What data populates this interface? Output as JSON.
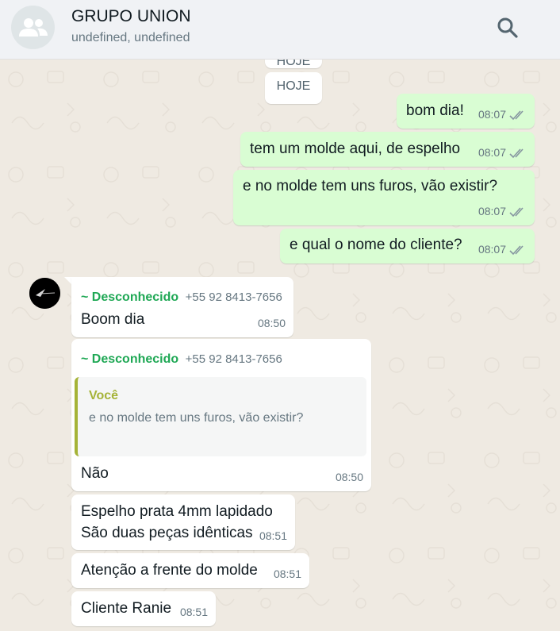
{
  "header": {
    "title": "GRUPO UNION",
    "subtitle": "undefined, undefined",
    "avatar_icon": "group-icon",
    "search_icon": "search-icon"
  },
  "chat": {
    "date_chip_top": "HOJE",
    "date_chip": "HOJE",
    "messages_out": [
      {
        "text": "bom dia!",
        "time": "08:07"
      },
      {
        "text": "tem um molde aqui, de espelho",
        "time": "08:07"
      },
      {
        "text": "e no molde tem uns furos, vão existir?",
        "time": "08:07"
      },
      {
        "text": "e qual o nome do cliente?",
        "time": "08:07"
      }
    ],
    "messages_in": [
      {
        "sender": "~ Desconhecido",
        "phone": "+55 92 8413-7656",
        "text": "Boom dia",
        "time": "08:50"
      },
      {
        "sender": "~ Desconhecido",
        "phone": "+55 92 8413-7656",
        "quote_author": "Você",
        "quote_text": "e no molde tem uns furos, vão existir?",
        "text": "Não",
        "time": "08:50"
      },
      {
        "text_line1": "Espelho prata 4mm lapidado",
        "text_line2": "São duas peças idênticas",
        "time": "08:51"
      },
      {
        "text": "Atenção a frente do molde",
        "time": "08:51"
      },
      {
        "text": "Cliente Ranie",
        "time": "08:51"
      }
    ]
  },
  "colors": {
    "outgoing_bubble": "#d9fdd3",
    "incoming_bubble": "#ffffff",
    "sender_name": "#1fa855",
    "quote_accent": "#a5b337",
    "chat_background": "#efeae2"
  }
}
